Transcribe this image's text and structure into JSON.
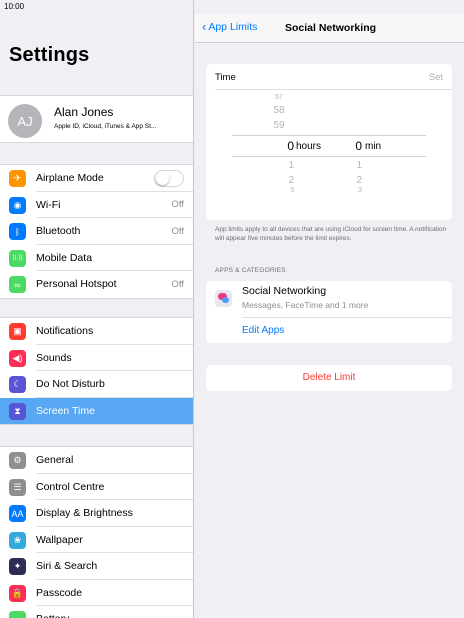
{
  "status_bar": {
    "time": "10:00"
  },
  "settings": {
    "title": "Settings",
    "profile": {
      "initials": "AJ",
      "name": "Alan Jones",
      "subtitle": "Apple ID, iCloud, iTunes & App St..."
    },
    "group1": [
      {
        "label": "Airplane Mode",
        "icon": "airplane-icon",
        "color": "#ff9500",
        "glyph": "✈",
        "toggle": true
      },
      {
        "label": "Wi-Fi",
        "icon": "wifi-icon",
        "color": "#007aff",
        "glyph": "◉",
        "value": "Off"
      },
      {
        "label": "Bluetooth",
        "icon": "bluetooth-icon",
        "color": "#007aff",
        "glyph": "ᛒ",
        "value": "Off"
      },
      {
        "label": "Mobile Data",
        "icon": "antenna-icon",
        "color": "#4cd964",
        "glyph": "((·))"
      },
      {
        "label": "Personal Hotspot",
        "icon": "hotspot-icon",
        "color": "#4cd964",
        "glyph": "∞",
        "value": "Off"
      }
    ],
    "group2": [
      {
        "label": "Notifications",
        "icon": "notifications-icon",
        "color": "#ff3b30",
        "glyph": "▣"
      },
      {
        "label": "Sounds",
        "icon": "speaker-icon",
        "color": "#ff2d55",
        "glyph": "◀)"
      },
      {
        "label": "Do Not Disturb",
        "icon": "moon-icon",
        "color": "#5856d6",
        "glyph": "☾"
      },
      {
        "label": "Screen Time",
        "icon": "hourglass-icon",
        "color": "#5856d6",
        "glyph": "⧗",
        "selected": true
      }
    ],
    "group3": [
      {
        "label": "General",
        "icon": "gear-icon",
        "color": "#8e8e93",
        "glyph": "⚙"
      },
      {
        "label": "Control Centre",
        "icon": "switches-icon",
        "color": "#8e8e93",
        "glyph": "☰"
      },
      {
        "label": "Display & Brightness",
        "icon": "text-size-icon",
        "color": "#007aff",
        "glyph": "AA"
      },
      {
        "label": "Wallpaper",
        "icon": "flower-icon",
        "color": "#34aadc",
        "glyph": "❀"
      },
      {
        "label": "Siri & Search",
        "icon": "siri-icon",
        "color": "#2c2c54",
        "glyph": "✦"
      },
      {
        "label": "Passcode",
        "icon": "lock-icon",
        "color": "#ff2d55",
        "glyph": "🔒"
      },
      {
        "label": "Battery",
        "icon": "battery-icon",
        "color": "#4cd964",
        "glyph": "▬"
      }
    ]
  },
  "detail": {
    "nav": {
      "back": "App Limits",
      "title": "Social Networking"
    },
    "time": {
      "label": "Time",
      "action": "Set",
      "hours_above": [
        "57",
        "58",
        "59"
      ],
      "hours_selected": "0",
      "hours_unit": "hours",
      "hours_below": [
        "1",
        "2",
        "3"
      ],
      "min_selected": "0",
      "min_unit": "min",
      "min_below": [
        "1",
        "2",
        "3"
      ]
    },
    "note": "App limits apply to all devices that are using iCloud for screen time. A notification will appear five minutes before the limit expires.",
    "section_header": "APPS & CATEGORIES",
    "category": {
      "name": "Social Networking",
      "subtitle": "Messages, FaceTime and 1 more"
    },
    "edit_apps": "Edit Apps",
    "delete": "Delete Limit"
  }
}
